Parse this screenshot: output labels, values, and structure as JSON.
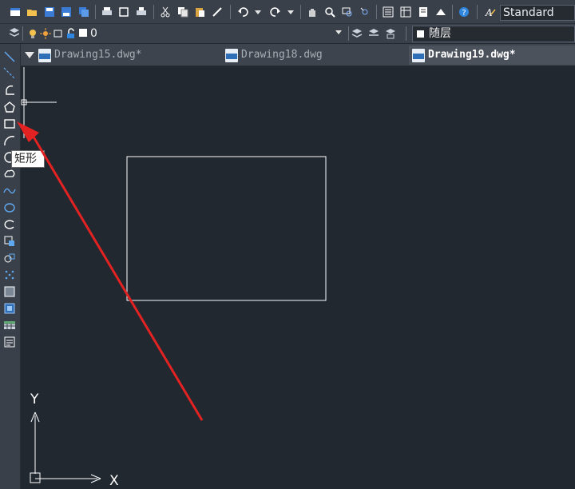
{
  "toolbar": {
    "text_style": "Standard",
    "text_style_icon": "text-style-icon"
  },
  "layer": {
    "current": "0"
  },
  "color": {
    "current": "随层"
  },
  "tabs": [
    {
      "label": "Drawing15.dwg*",
      "active": false
    },
    {
      "label": "Drawing18.dwg",
      "active": false
    },
    {
      "label": "Drawing19.dwg*",
      "active": true
    }
  ],
  "tooltip": {
    "text": "矩形"
  },
  "ucs": {
    "x_label": "X",
    "y_label": "Y"
  },
  "colors": {
    "canvas": "#212830",
    "toolbar": "#3a4049",
    "annotation_arrow": "#e32222",
    "drawing_lines": "#ffffff"
  }
}
